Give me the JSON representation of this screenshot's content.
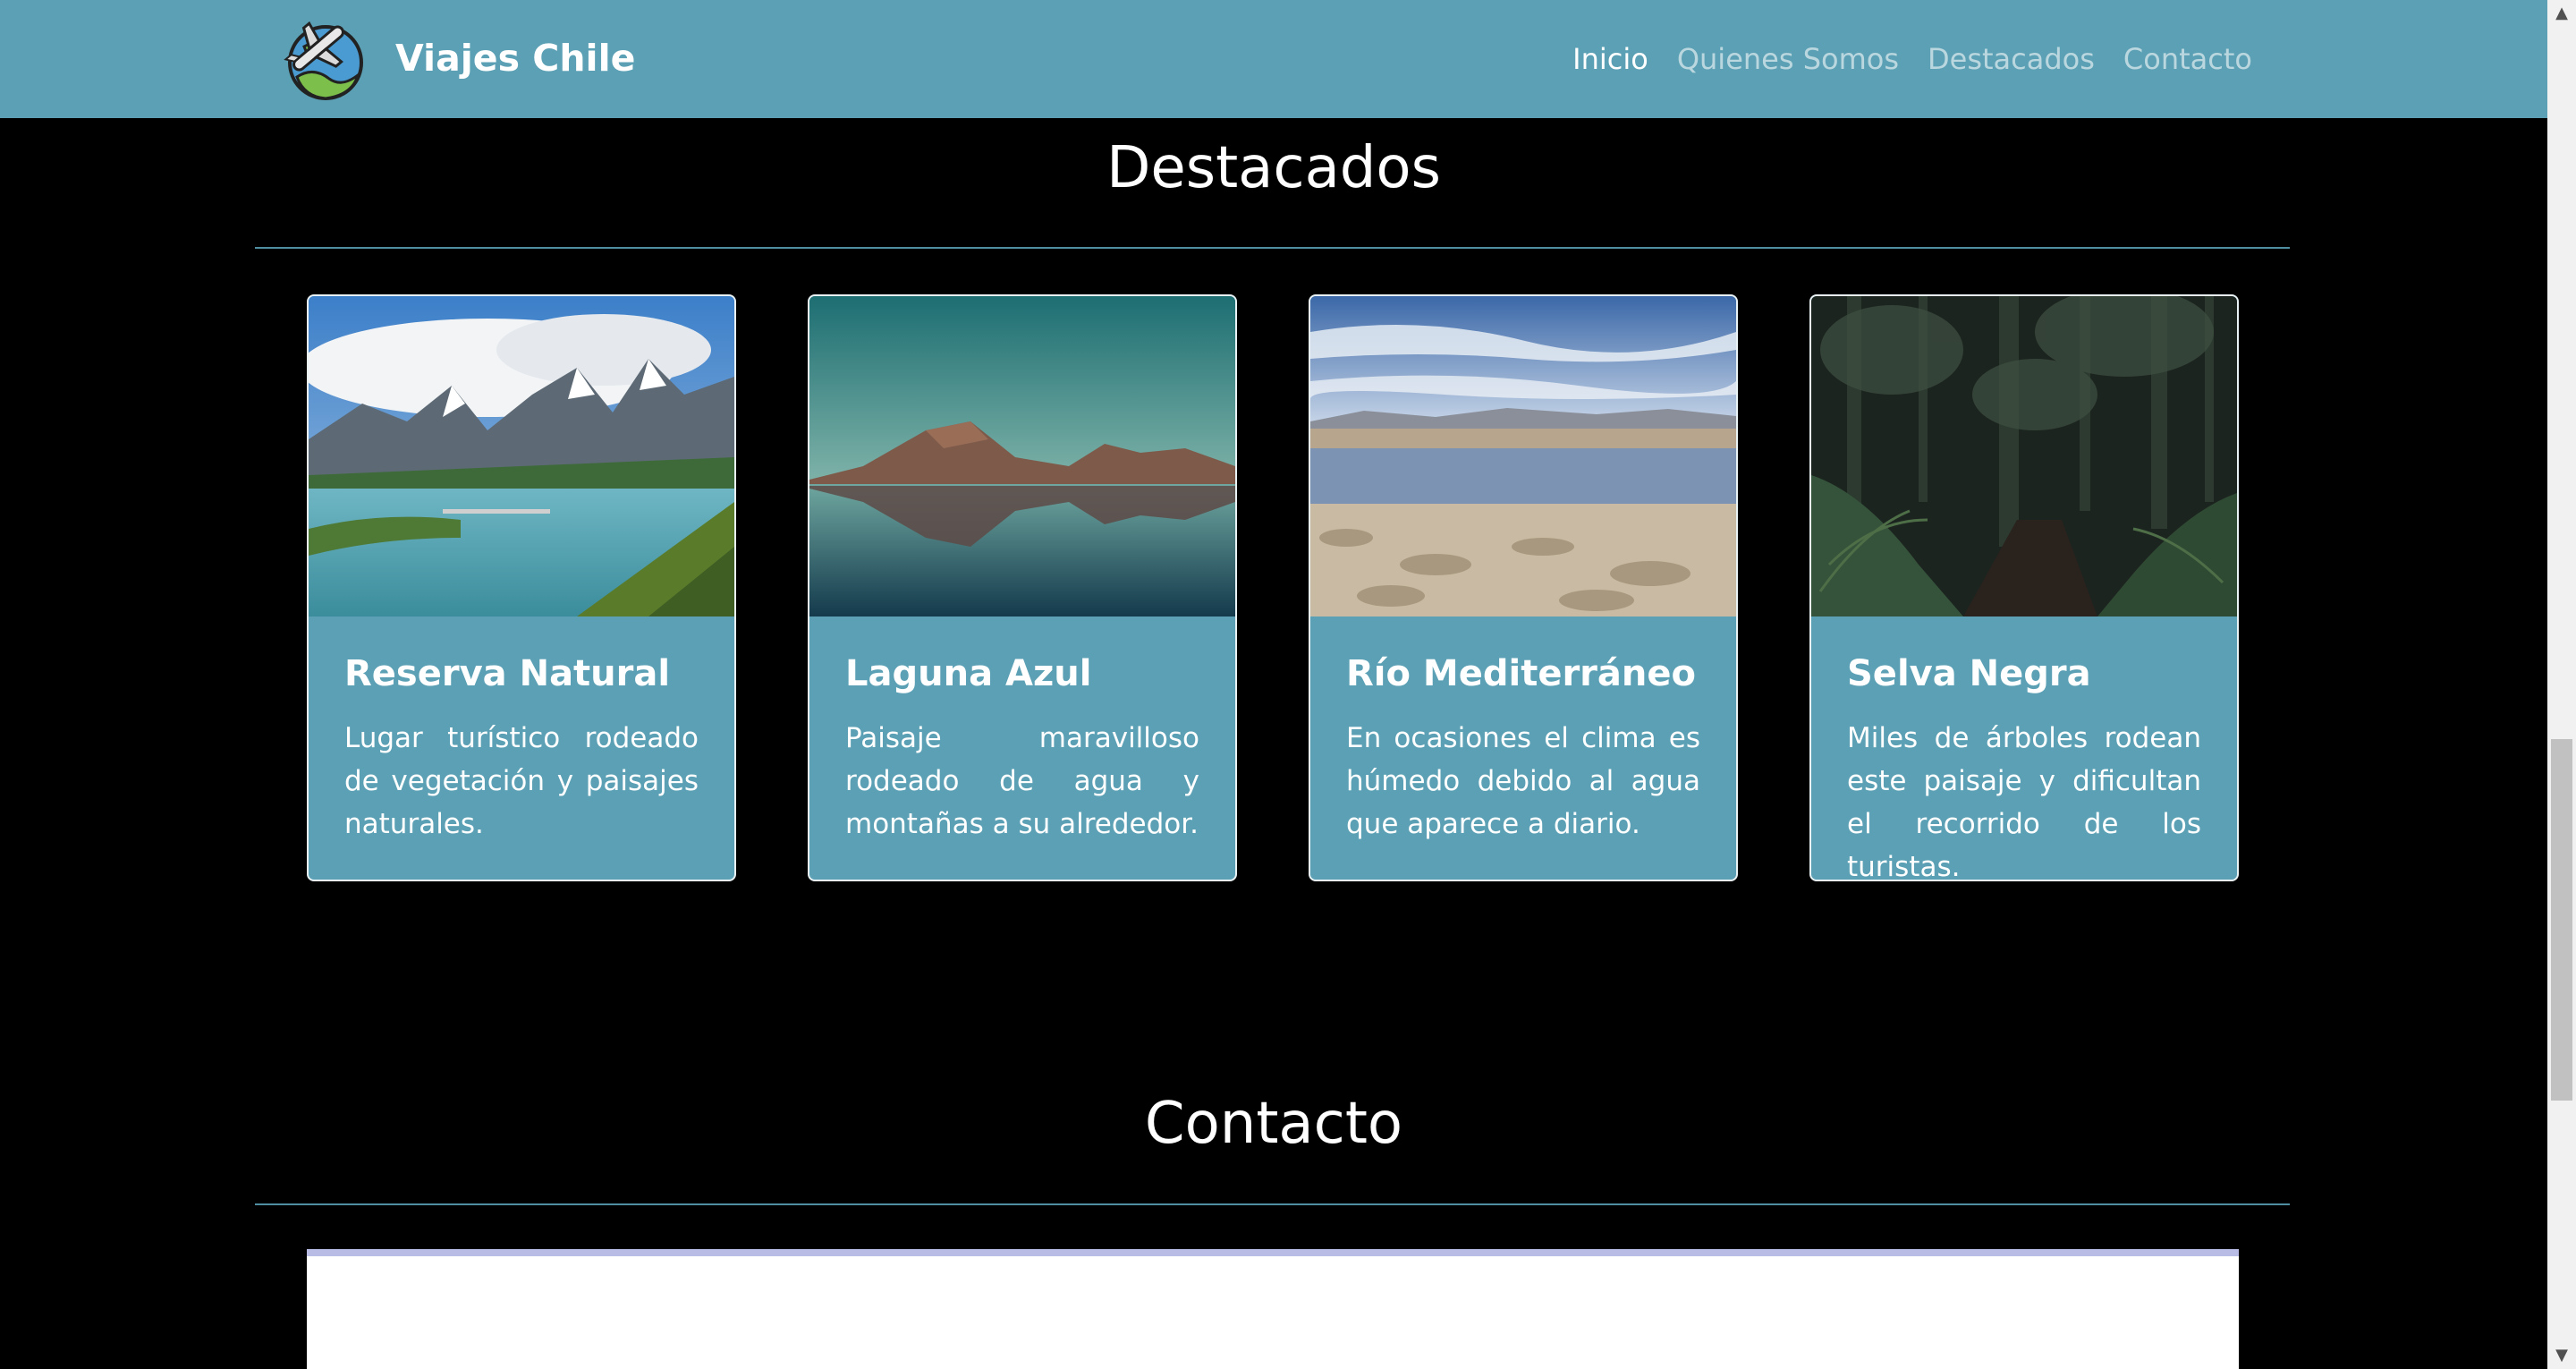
{
  "brand": {
    "name": "Viajes Chile",
    "logo_icon": "airplane-globe-icon"
  },
  "nav": {
    "items": [
      {
        "label": "Inicio",
        "active": true
      },
      {
        "label": "Quienes Somos",
        "active": false
      },
      {
        "label": "Destacados",
        "active": false
      },
      {
        "label": "Contacto",
        "active": false
      }
    ]
  },
  "featured": {
    "title": "Destacados",
    "cards": [
      {
        "title": "Reserva Natural",
        "text": "Lugar turístico rodeado de vegetación y paisajes naturales.",
        "image": "mountain-lake-photo"
      },
      {
        "title": "Laguna Azul",
        "text": "Paisaje maravilloso rodeado de agua y montañas a su alrededor.",
        "image": "lagoon-reflection-photo"
      },
      {
        "title": "Río Mediterráneo",
        "text": "En ocasiones el clima es húmedo debido al agua que aparece a diario.",
        "image": "salt-flat-river-photo"
      },
      {
        "title": "Selva Negra",
        "text": "Miles de árboles rodean este paisaje y dificultan el recorrido de los turistas.",
        "image": "dark-forest-photo"
      }
    ]
  },
  "contact": {
    "title": "Contacto"
  },
  "colors": {
    "navbar": "#5ba0b4",
    "card": "#5ba0b4",
    "background": "#000000",
    "divider": "#4f8ea0"
  }
}
